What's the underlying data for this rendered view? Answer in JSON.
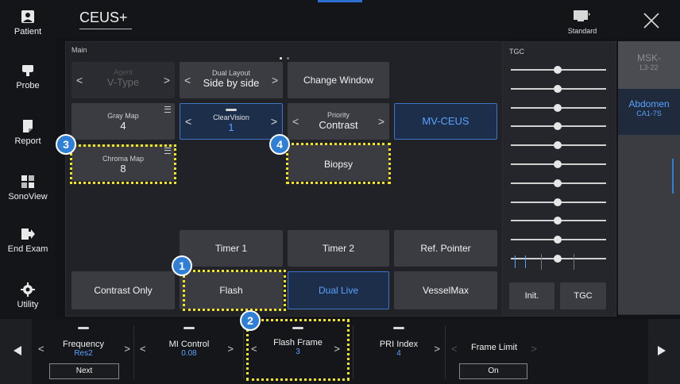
{
  "header": {
    "title": "CEUS+",
    "display_label": "Standard"
  },
  "sidebar": {
    "items": [
      {
        "label": "Patient",
        "icon": "patient-icon"
      },
      {
        "label": "Probe",
        "icon": "probe-icon"
      },
      {
        "label": "Report",
        "icon": "report-icon"
      },
      {
        "label": "SonoView",
        "icon": "sonoview-icon"
      },
      {
        "label": "End Exam",
        "icon": "end-exam-icon"
      },
      {
        "label": "Utility",
        "icon": "gear-icon"
      }
    ]
  },
  "main": {
    "panel_label": "Main",
    "agent": {
      "label": "Agent",
      "value": "V-Type"
    },
    "dual_layout": {
      "label": "Dual Layout",
      "value": "Side by side"
    },
    "change_window": "Change Window",
    "gray_map": {
      "label": "Gray Map",
      "value": "4"
    },
    "clearvision": {
      "label": "ClearVision",
      "value": "1"
    },
    "priority": {
      "label": "Priority",
      "value": "Contrast"
    },
    "mv_ceus": "MV-CEUS",
    "chroma_map": {
      "label": "Chroma Map",
      "value": "8"
    },
    "biopsy": "Biopsy",
    "timer1": "Timer 1",
    "timer2": "Timer 2",
    "ref_pointer": "Ref. Pointer",
    "contrast_only": "Contrast Only",
    "flash": "Flash",
    "dual_live": "Dual Live",
    "vesselmax": "VesselMax"
  },
  "callouts": [
    "1",
    "2",
    "3",
    "4"
  ],
  "tgc": {
    "label": "TGC",
    "init": "Init.",
    "tgc_button": "TGC",
    "slider_count": 11
  },
  "probes": [
    {
      "name": "MSK-",
      "model": "L3-22",
      "active": false
    },
    {
      "name": "Abdomen",
      "model": "CA1-7S",
      "active": true
    }
  ],
  "bottom": {
    "frequency": {
      "label": "Frequency",
      "value": "Res2",
      "button": "Next"
    },
    "mi_control": {
      "label": "MI Control",
      "value": "0.08"
    },
    "flash_frame": {
      "label": "Flash Frame",
      "value": "3"
    },
    "pri_index": {
      "label": "PRI Index",
      "value": "4"
    },
    "frame_limit": {
      "label": "Frame Limit",
      "button": "On"
    }
  },
  "colors": {
    "accent": "#2f7fd6",
    "highlight": "#f2e51a",
    "value_text": "#5aa2ff"
  }
}
